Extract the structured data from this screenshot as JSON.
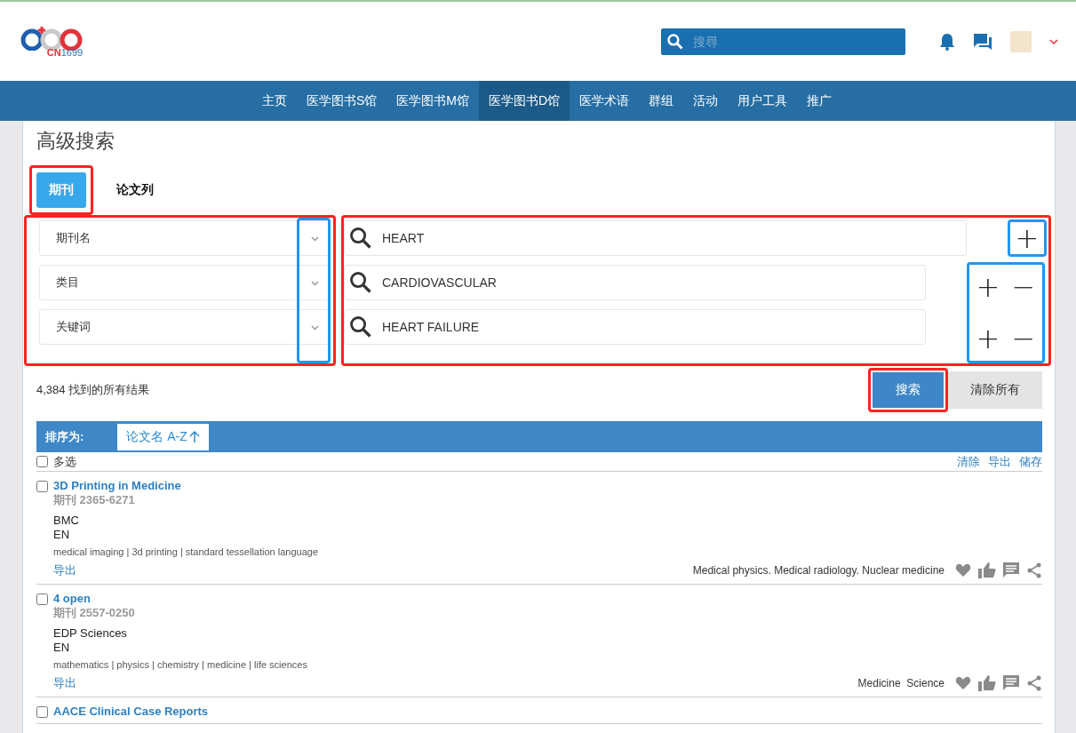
{
  "header": {
    "logo_text": "CN",
    "logo_number": "1699",
    "search": {
      "placeholder": "搜尋"
    }
  },
  "nav": [
    {
      "label": "主页",
      "selected": false
    },
    {
      "label": "医学图书S馆",
      "selected": false
    },
    {
      "label": "医学图书M馆",
      "selected": false
    },
    {
      "label": "医学图书D馆",
      "selected": true
    },
    {
      "label": "医学术语",
      "selected": false
    },
    {
      "label": "群组",
      "selected": false
    },
    {
      "label": "活动",
      "selected": false
    },
    {
      "label": "用户工具",
      "selected": false
    },
    {
      "label": "推广",
      "selected": false
    }
  ],
  "title": "高级搜索",
  "tabs": [
    {
      "label": "期刊",
      "selected": true
    },
    {
      "label": "论文列",
      "selected": false
    }
  ],
  "criteria": [
    {
      "field": "期刊名",
      "value": "HEART",
      "buttons": [
        "+"
      ]
    },
    {
      "field": "类目",
      "value": "CARDIOVASCULAR",
      "buttons": [
        "+",
        "−"
      ]
    },
    {
      "field": "关键词",
      "value": "HEART FAILURE",
      "buttons": [
        "+",
        "−"
      ]
    }
  ],
  "result_count": "4,384 找到的所有结果",
  "search_button": "搜索",
  "clear_button": "清除所有",
  "sort": {
    "label": "排序为:",
    "value": "论文名 A-Z"
  },
  "select_all": {
    "label": "多选",
    "checked": false
  },
  "list_actions": [
    "清除",
    "导出",
    "储存"
  ],
  "results": [
    {
      "title": "3D Printing in Medicine",
      "issn": "期刊 2365-6271",
      "publisher": "BMC",
      "language": "EN",
      "keywords": "medical imaging | 3d printing | standard tessellation language",
      "export": "导出",
      "subjects": "Medical physics. Medical radiology. Nuclear medicine",
      "checked": false
    },
    {
      "title": "4 open",
      "issn": "期刊 2557-0250",
      "publisher": "EDP Sciences",
      "language": "EN",
      "keywords": "mathematics | physics | chemistry | medicine | life sciences",
      "export": "导出",
      "subjects": "Medicine  Science",
      "checked": false
    },
    {
      "title": "AACE Clinical Case Reports",
      "checked": false
    }
  ]
}
